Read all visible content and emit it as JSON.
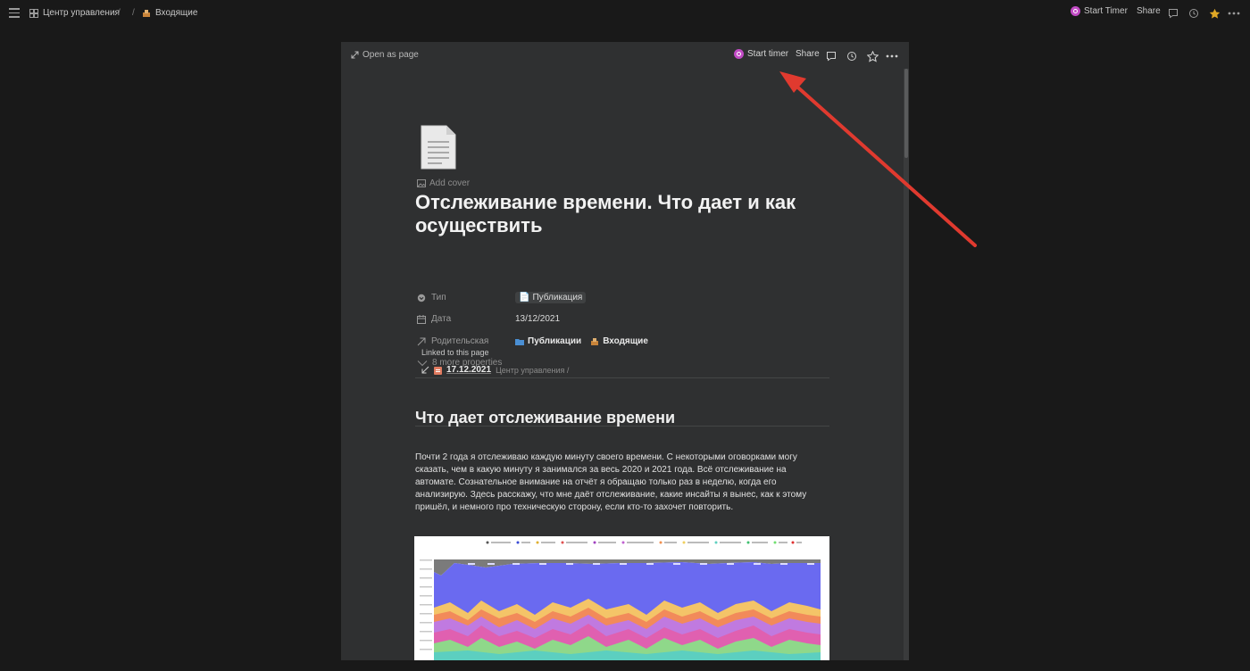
{
  "topbar": {
    "breadcrumb_workspace": "Центр управления",
    "breadcrumb_sep": "/",
    "breadcrumb_sep2": "/",
    "breadcrumb_inbox": "Входящие",
    "start_timer_label": "Start Timer",
    "share_label": "Share"
  },
  "modal": {
    "open_as_page_label": "Open as page",
    "start_timer_label": "Start timer",
    "share_label": "Share"
  },
  "page": {
    "add_cover_label": "Add cover",
    "title": "Отслеживание времени. Что дает и как осуществить",
    "properties": [
      {
        "name": "Тип",
        "value": "Публикация"
      },
      {
        "name": "Дата",
        "value": "13/12/2021"
      },
      {
        "name": "Родительская",
        "value_1": "Публикации",
        "value_2": "Входящие"
      }
    ],
    "more_properties_label": "8 more properties",
    "linked": {
      "title": "Linked to this page",
      "date": "17.12.2021",
      "path": "Центр управления /"
    },
    "heading": "Что дает отслеживание времени",
    "paragraph": "Почти 2 года я отслеживаю каждую минуту своего времени. С некоторыми оговорками могу сказать, чем в какую минуту я занимался за весь 2020 и 2021 года. Всё отслеживание на автомате. Сознательное внимание на отчёт я обращаю только раз в неделю, когда его анализирую. Здесь расскажу, что мне даёт отслеживание, какие инсайты я вынес, как к этому пришёл, и немного про техническую сторону, если кто-то захочет повторить."
  },
  "colors": {
    "background": "#191919",
    "modal_bg": "#2f3031",
    "timer_accent": "#c14bc4",
    "favorite_star": "#e0a825",
    "arrow": "#e03a2f"
  },
  "icons": {
    "menu": "hamburger-icon",
    "workspace": "grid-icon",
    "timer": "timer-icon",
    "comment": "comment-icon",
    "history": "clock-icon",
    "favorite": "star-icon",
    "more": "more-icon"
  }
}
